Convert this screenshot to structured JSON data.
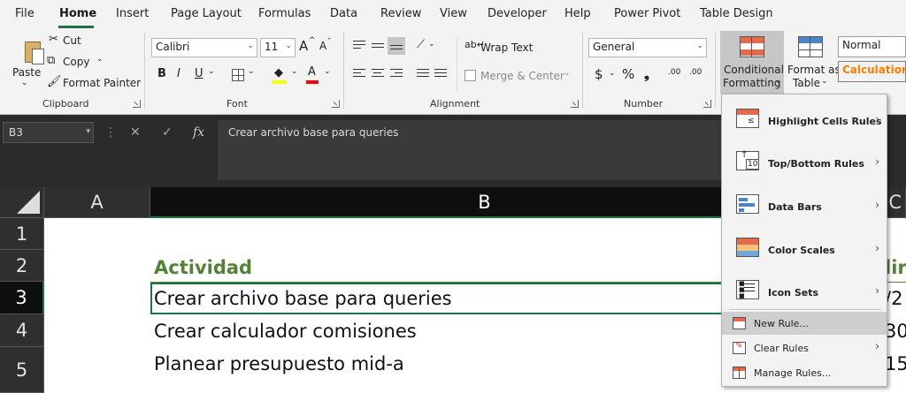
{
  "menu_tabs": [
    "File",
    "Home",
    "Insert",
    "Page Layout",
    "Formulas",
    "Data",
    "Review",
    "View",
    "Developer",
    "Help",
    "Power Pivot",
    "Table Design"
  ],
  "active_tab": "Home",
  "ribbon": {
    "clipboard": {
      "paste_label": "Paste",
      "cut_label": "Cut",
      "copy_label": "Copy",
      "format_painter_label": "Format Painter",
      "group_label": "Clipboard"
    },
    "font": {
      "font_name": "Calibri",
      "font_size": "11",
      "grow_label": "A",
      "shrink_label": "A",
      "bold_label": "B",
      "italic_label": "I",
      "underline_label": "U",
      "group_label": "Font"
    },
    "alignment": {
      "wrap_text_label": "Wrap Text",
      "merge_center_label": "Merge & Center",
      "group_label": "Alignment"
    },
    "number": {
      "format_value": "General",
      "currency_symbol": "$",
      "percent_symbol": "%",
      "comma_symbol": "❟",
      "inc_decimal": ".00",
      "dec_decimal": ".00",
      "group_label": "Number"
    },
    "styles": {
      "conditional_formatting_line1": "Conditional",
      "conditional_formatting_line2": "Formatting",
      "format_as_table_line1": "Format as",
      "format_as_table_line2": "Table",
      "style_normal": "Normal",
      "style_calculation": "Calculation"
    }
  },
  "formula_bar": {
    "name_box": "B3",
    "fx_label": "fx",
    "content": "Crear archivo base para queries"
  },
  "grid": {
    "columns": [
      "A",
      "B",
      "C"
    ],
    "rows": [
      "1",
      "2",
      "3",
      "4",
      "5"
    ],
    "cells": {
      "B2": "Actividad",
      "B3": "Crear archivo base para queries",
      "B4": "Crear calculador comisiones",
      "B5": "Planear presupuesto mid-a",
      "C2": "lir",
      "C3": "/2",
      "C4": "30",
      "C5": "15"
    }
  },
  "cf_menu": {
    "items": [
      {
        "label": "Highlight Cells Rules",
        "icon": "highlight-cells-icon",
        "submenu": true
      },
      {
        "label": "Top/Bottom Rules",
        "icon": "top-bottom-icon",
        "submenu": true
      },
      {
        "label": "Data Bars",
        "icon": "data-bars-icon",
        "submenu": true
      },
      {
        "label": "Color Scales",
        "icon": "color-scales-icon",
        "submenu": true
      },
      {
        "label": "Icon Sets",
        "icon": "icon-sets-icon",
        "submenu": true
      }
    ],
    "small_items": [
      {
        "label": "New Rule...",
        "icon": "new-rule-icon",
        "submenu": false
      },
      {
        "label": "Clear Rules",
        "icon": "clear-rules-icon",
        "submenu": true
      },
      {
        "label": "Manage Rules...",
        "icon": "manage-rules-icon",
        "submenu": false
      }
    ],
    "top_bottom_badge": "10"
  },
  "colors": {
    "accent": "#217346",
    "header_text": "#538135",
    "calculation_text": "#fa7d00"
  }
}
